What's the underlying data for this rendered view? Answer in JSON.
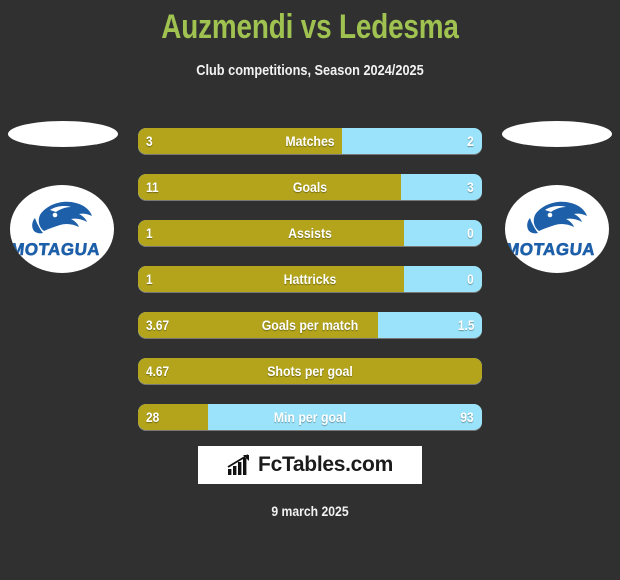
{
  "header": {
    "title": "Auzmendi vs Ledesma",
    "subtitle": "Club competitions, Season 2024/2025",
    "title_color": "#9fc250"
  },
  "teams": {
    "home": {
      "club_name": "MOTAGUA",
      "logo_icon": "motagua-eagle-logo"
    },
    "away": {
      "club_name": "MOTAGUA",
      "logo_icon": "motagua-eagle-logo"
    }
  },
  "colors": {
    "background": "#303030",
    "home_bar": "#b3a41b",
    "away_bar": "#9ae3fa",
    "text": "#ffffff"
  },
  "stats": [
    {
      "label": "Matches",
      "home": "3",
      "away": "2",
      "home_pct": 59.3
    },
    {
      "label": "Goals",
      "home": "11",
      "away": "3",
      "home_pct": 76.5
    },
    {
      "label": "Assists",
      "home": "1",
      "away": "0",
      "home_pct": 77.3
    },
    {
      "label": "Hattricks",
      "home": "1",
      "away": "0",
      "home_pct": 77.3
    },
    {
      "label": "Goals per match",
      "home": "3.67",
      "away": "1.5",
      "home_pct": 69.8
    },
    {
      "label": "Shots per goal",
      "home": "4.67",
      "away": "",
      "home_pct": 100
    },
    {
      "label": "Min per goal",
      "home": "28",
      "away": "93",
      "home_pct": 20.3
    }
  ],
  "footer": {
    "brand_text": "FcTables.com",
    "brand_icon": "bar-chart-growth-icon",
    "date": "9 march 2025"
  }
}
